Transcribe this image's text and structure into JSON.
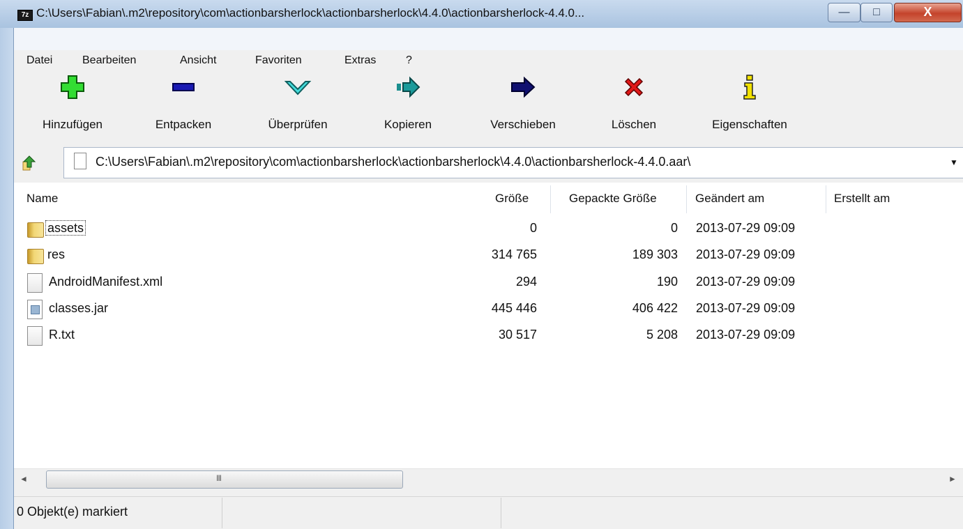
{
  "window": {
    "title": "C:\\Users\\Fabian\\.m2\\repository\\com\\actionbarsherlock\\actionbarsherlock\\4.4.0\\actionbarsherlock-4.4.0...",
    "app_icon_text": "7z",
    "min_glyph": "—",
    "max_glyph": "□",
    "close_glyph": "X"
  },
  "menu": {
    "items": [
      "Datei",
      "Bearbeiten",
      "Ansicht",
      "Favoriten",
      "Extras",
      "?"
    ]
  },
  "toolbar": {
    "items": [
      {
        "label": "Hinzufügen",
        "icon": "add-plus-icon",
        "color": "#33cc33"
      },
      {
        "label": "Entpacken",
        "icon": "extract-minus-icon",
        "color": "#1a1aa6"
      },
      {
        "label": "Überprüfen",
        "icon": "test-check-icon",
        "color": "#33cccc"
      },
      {
        "label": "Kopieren",
        "icon": "copy-arrow-icon",
        "color": "#1a8f8f"
      },
      {
        "label": "Verschieben",
        "icon": "move-arrow-icon",
        "color": "#10106a"
      },
      {
        "label": "Löschen",
        "icon": "delete-x-icon",
        "color": "#e01818"
      },
      {
        "label": "Eigenschaften",
        "icon": "info-icon",
        "color": "#e6d800"
      }
    ]
  },
  "address": {
    "path": "C:\\Users\\Fabian\\.m2\\repository\\com\\actionbarsherlock\\actionbarsherlock\\4.4.0\\actionbarsherlock-4.4.0.aar\\",
    "dropdown_glyph": "▼"
  },
  "columns": {
    "name": "Name",
    "size": "Größe",
    "packed": "Gepackte Größe",
    "modified": "Geändert am",
    "created": "Erstellt am"
  },
  "files": [
    {
      "name": "assets",
      "type": "folder",
      "size": "0",
      "packed": "0",
      "modified": "2013-07-29 09:09",
      "created": ""
    },
    {
      "name": "res",
      "type": "folder",
      "size": "314 765",
      "packed": "189 303",
      "modified": "2013-07-29 09:09",
      "created": ""
    },
    {
      "name": "AndroidManifest.xml",
      "type": "file",
      "size": "294",
      "packed": "190",
      "modified": "2013-07-29 09:09",
      "created": ""
    },
    {
      "name": "classes.jar",
      "type": "jar",
      "size": "445 446",
      "packed": "406 422",
      "modified": "2013-07-29 09:09",
      "created": ""
    },
    {
      "name": "R.txt",
      "type": "file",
      "size": "30 517",
      "packed": "5 208",
      "modified": "2013-07-29 09:09",
      "created": ""
    }
  ],
  "scroll": {
    "left_glyph": "◄",
    "right_glyph": "►",
    "grip": "III"
  },
  "status": {
    "text": "0 Objekt(e) markiert"
  }
}
